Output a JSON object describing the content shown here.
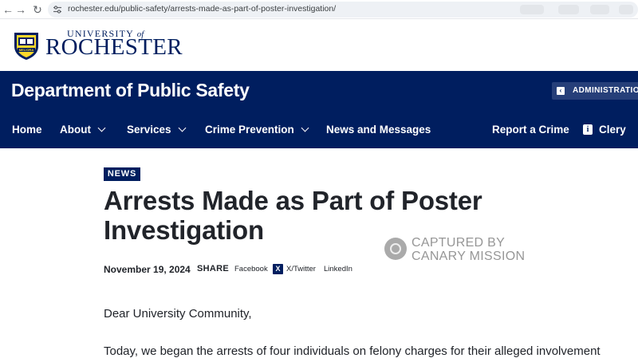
{
  "browser": {
    "url": "rochester.edu/public-safety/arrests-made-as-part-of-poster-investigation/",
    "icons": [
      "back-arrow-icon",
      "forward-arrow-icon",
      "reload-icon",
      "site-info-icon"
    ]
  },
  "logo": {
    "line1": "UNIVERSITY",
    "line1_of": "of",
    "line2": "ROCHESTER",
    "seal_motto": "MELIORA"
  },
  "department": {
    "title": "Department of Public Safety",
    "admin_button": "ADMINISTRATION"
  },
  "nav": {
    "items": [
      "Home",
      "About",
      "Services",
      "Crime Prevention",
      "News and Messages"
    ],
    "report": "Report a Crime",
    "clery": "Clery"
  },
  "article": {
    "category": "NEWS",
    "title": "Arrests Made as Part of Poster Investigation",
    "date": "November 19, 2024",
    "share_label": "SHARE",
    "share_links": [
      "Facebook",
      "X/Twitter",
      "LinkedIn"
    ],
    "paragraphs": [
      "Dear University Community,",
      "Today, we began the arrests of four individuals on felony charges for their alleged involvement"
    ]
  },
  "watermark": {
    "line1": "CAPTURED BY",
    "line2": "CANARY MISSION"
  },
  "colors": {
    "brand_navy": "#001e5f",
    "admin_button_bg": "#263f79",
    "text": "#21242a"
  }
}
